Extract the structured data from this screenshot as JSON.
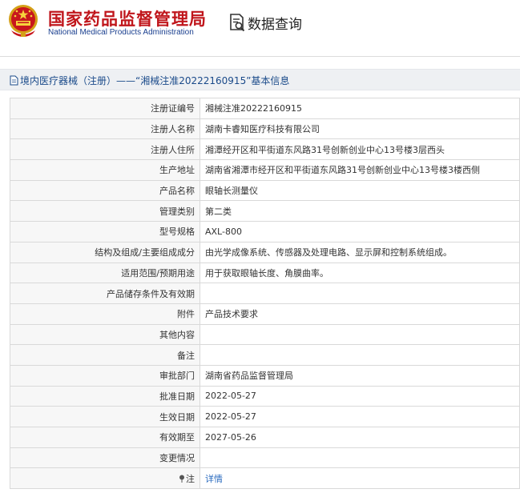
{
  "header": {
    "org_cn": "国家药品监督管理局",
    "org_en": "National Medical Products Administration",
    "query_title": "数据查询",
    "emblem_icon": "national-emblem-icon",
    "query_icon": "document-search-icon",
    "brand_red": "#c0161c",
    "brand_blue": "#1a3f8f"
  },
  "breadcrumb": {
    "text": "境内医疗器械（注册）——“湘械注准20222160915”基本信息",
    "icon": "document-icon"
  },
  "details": [
    {
      "label": "注册证编号",
      "value": "湘械注准20222160915"
    },
    {
      "label": "注册人名称",
      "value": "湖南卡睿知医疗科技有限公司"
    },
    {
      "label": "注册人住所",
      "value": "湘潭经开区和平街道东风路31号创新创业中心13号楼3层西头"
    },
    {
      "label": "生产地址",
      "value": "湖南省湘潭市经开区和平街道东风路31号创新创业中心13号楼3楼西侧"
    },
    {
      "label": "产品名称",
      "value": "眼轴长测量仪"
    },
    {
      "label": "管理类别",
      "value": "第二类"
    },
    {
      "label": "型号规格",
      "value": "AXL-800"
    },
    {
      "label": "结构及组成/主要组成成分",
      "value": "由光学成像系统、传感器及处理电路、显示屏和控制系统组成。"
    },
    {
      "label": "适用范围/预期用途",
      "value": "用于获取眼轴长度、角膜曲率。"
    },
    {
      "label": "产品储存条件及有效期",
      "value": ""
    },
    {
      "label": "附件",
      "value": "产品技术要求"
    },
    {
      "label": "其他内容",
      "value": ""
    },
    {
      "label": "备注",
      "value": ""
    },
    {
      "label": "审批部门",
      "value": "湖南省药品监督管理局"
    },
    {
      "label": "批准日期",
      "value": "2022-05-27"
    },
    {
      "label": "生效日期",
      "value": "2022-05-27"
    },
    {
      "label": "有效期至",
      "value": "2027-05-26"
    },
    {
      "label": "变更情况",
      "value": ""
    }
  ],
  "note": {
    "label": "注",
    "link_text": "详情",
    "icon": "pin-icon",
    "link_color": "#2a6bbf"
  }
}
